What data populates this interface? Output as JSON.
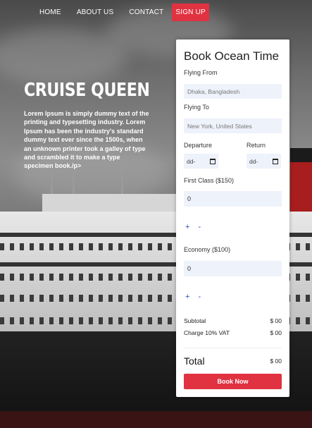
{
  "nav": {
    "home": "HOME",
    "about": "ABOUT US",
    "contact": "CONTACT",
    "signup": "SIGN UP"
  },
  "hero": {
    "title": "CRUISE QUEEN",
    "text": "Lorem Ipsum is simply dummy text of the printing and typesetting industry. Lorem Ipsum has been the industry's standard dummy text ever since the 1500s, when an unknown printer took a galley of type and scrambled it to make a type specimen book./p>"
  },
  "booking": {
    "title": "Book Ocean Time",
    "flying_from_label": "Flying From",
    "flying_from_value": "Dhaka, Bangladesh",
    "flying_to_label": "Flying To",
    "flying_to_value": "New York, United States",
    "departure_label": "Departure",
    "return_label": "Return",
    "date_placeholder": "dd-",
    "first_class_label": "First Class ($150)",
    "first_class_qty": "0",
    "economy_label": "Economy ($100)",
    "economy_qty": "0",
    "plus": "+",
    "minus": "-",
    "subtotal_label": "Subtotal",
    "subtotal_value": "$ 00",
    "vat_label": "Charge 10% VAT",
    "vat_value": "$ 00",
    "total_label": "Total",
    "total_value": "$ 00",
    "book_now": "Book Now"
  }
}
